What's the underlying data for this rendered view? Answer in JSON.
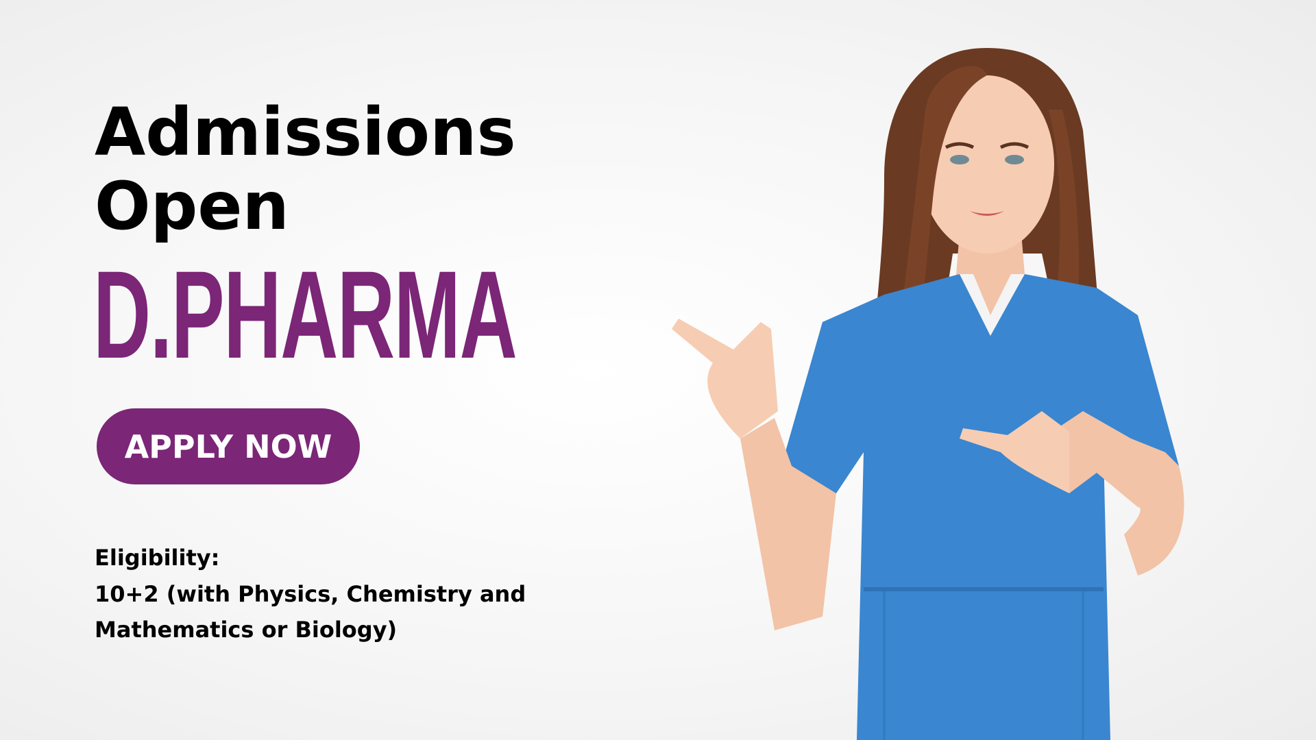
{
  "headline": {
    "line1": "Admissions",
    "line2": "Open"
  },
  "program": "D.PHARMA",
  "cta": {
    "label": "APPLY NOW"
  },
  "eligibility": {
    "title": "Eligibility:",
    "line1": "10+2 (with Physics, Chemistry and",
    "line2": "Mathematics or Biology)"
  },
  "colors": {
    "accent": "#7b2677",
    "scrubs": "#3a86d0",
    "text": "#000000"
  },
  "image": {
    "subject": "smiling woman in blue scrubs pointing left"
  }
}
